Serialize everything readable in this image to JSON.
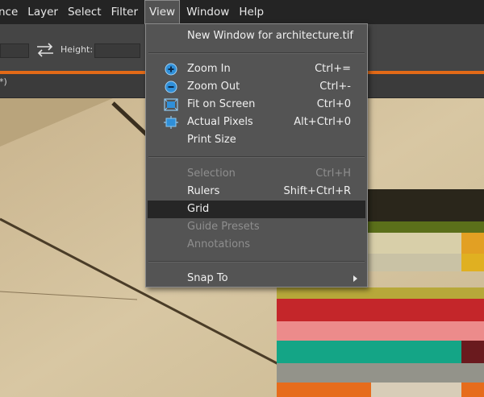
{
  "menubar": {
    "items": [
      "nce",
      "Layer",
      "Select",
      "Filter",
      "View",
      "Window",
      "Help"
    ],
    "active_index": 4
  },
  "options_bar": {
    "height_label": "Height:",
    "swap_icon": "swap-arrows-icon"
  },
  "tab_strip": {
    "text": "*)"
  },
  "view_menu": {
    "new_window": "New Window for architecture.tif",
    "zoom_in": {
      "label": "Zoom In",
      "shortcut": "Ctrl+=",
      "icon": "zoom-in-icon"
    },
    "zoom_out": {
      "label": "Zoom Out",
      "shortcut": "Ctrl+-",
      "icon": "zoom-out-icon"
    },
    "fit_on_screen": {
      "label": "Fit on Screen",
      "shortcut": "Ctrl+0",
      "icon": "fit-on-screen-icon"
    },
    "actual_pixels": {
      "label": "Actual Pixels",
      "shortcut": "Alt+Ctrl+0",
      "icon": "actual-pixels-icon"
    },
    "print_size": {
      "label": "Print Size"
    },
    "selection": {
      "label": "Selection",
      "shortcut": "Ctrl+H",
      "disabled": true
    },
    "rulers": {
      "label": "Rulers",
      "shortcut": "Shift+Ctrl+R"
    },
    "grid": {
      "label": "Grid",
      "highlighted": true
    },
    "guide_presets": {
      "label": "Guide Presets",
      "disabled": true
    },
    "annotations": {
      "label": "Annotations",
      "disabled": true
    },
    "snap_to": {
      "label": "Snap To",
      "submenu": true
    }
  },
  "colors": {
    "accent_orange": "#e36a17",
    "menu_bg": "#545454",
    "highlight_bg": "#262626",
    "icon_blue": "#2f8fd8"
  }
}
